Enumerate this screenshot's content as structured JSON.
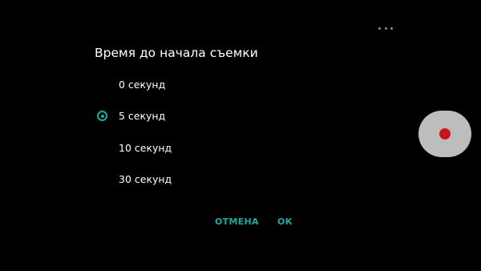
{
  "dialog": {
    "title": "Время до начала съемки",
    "options": [
      {
        "label": "0 секунд",
        "selected": false
      },
      {
        "label": "5 секунд",
        "selected": true
      },
      {
        "label": "10 секунд",
        "selected": false
      },
      {
        "label": "30 секунд",
        "selected": false
      }
    ],
    "cancel_label": "ОТМЕНА",
    "ok_label": "ОК"
  },
  "icons": {
    "overflow_menu": "more-dots-icon",
    "record_button": "record-icon"
  },
  "colors": {
    "background": "#000000",
    "accent": "#1fa8a0",
    "record": "#c8161d",
    "shutter_bg": "#bdbdbd"
  }
}
